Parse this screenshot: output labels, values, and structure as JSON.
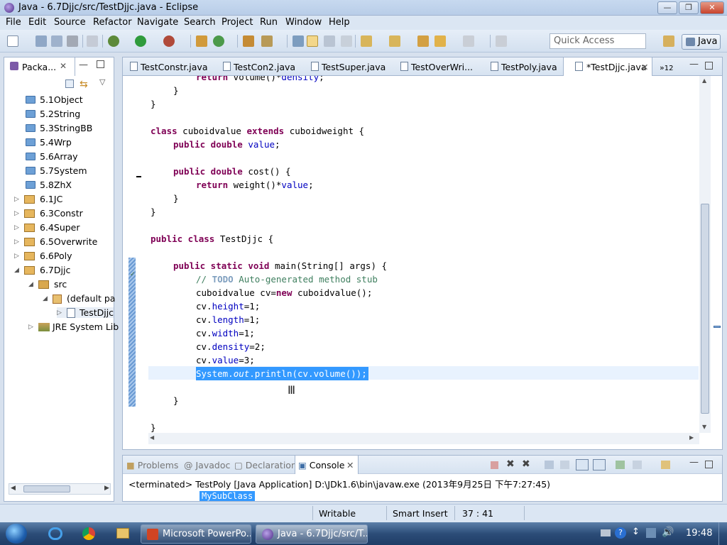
{
  "window": {
    "title": "Java - 6.7Djjc/src/TestDjjc.java - Eclipse"
  },
  "menu": [
    "File",
    "Edit",
    "Source",
    "Refactor",
    "Navigate",
    "Search",
    "Project",
    "Run",
    "Window",
    "Help"
  ],
  "toolbar": {
    "quick_access_placeholder": "Quick Access",
    "perspective": "Java"
  },
  "package_explorer": {
    "tab": "Packa...",
    "items": [
      "5.1Object",
      "5.2String",
      "5.3StringBB",
      "5.4Wrp",
      "5.6Array",
      "5.7System",
      "5.8ZhX",
      "6.1JC",
      "6.3Constr",
      "6.4Super",
      "6.5Overwrite",
      "6.6Poly",
      "6.7Djjc",
      "src",
      "(default pa",
      "TestDjjc",
      "JRE System Lib"
    ]
  },
  "editor": {
    "tabs": [
      "TestConstr.java",
      "TestCon2.java",
      "TestSuper.java",
      "TestOverWri...",
      "TestPoly.java",
      "*TestDjjc.java"
    ],
    "overflow_count": "12",
    "code": {
      "l0": "return volume()*density;",
      "l1": "}",
      "l2": "}",
      "l3_kw1": "class",
      "l3_name": " cuboidvalue ",
      "l3_kw2": "extends",
      "l3_rest": " cuboidweight {",
      "l4_kw": "public double",
      "l4_field": "value",
      "l4_end": ";",
      "l5_kw": "public double",
      "l5_rest": " cost() {",
      "l6_kw": "return",
      "l6_rest": " weight()*",
      "l6_field": "value",
      "l6_end": ";",
      "l7": "}",
      "l8": "}",
      "l9_kw": "public class",
      "l9_rest": " TestDjjc {",
      "l10_kw": "public static void",
      "l10_rest": " main(String[] args) {",
      "l11_c1": "// ",
      "l11_todo": "TODO",
      "l11_c2": " Auto-generated method stub",
      "l12_a": "cuboidvalue cv=",
      "l12_kw": "new",
      "l12_b": " cuboidvalue();",
      "l13_a": "cv.",
      "l13_f": "height",
      "l13_b": "=1;",
      "l14_a": "cv.",
      "l14_f": "length",
      "l14_b": "=1;",
      "l15_a": "cv.",
      "l15_f": "width",
      "l15_b": "=1;",
      "l16_a": "cv.",
      "l16_f": "density",
      "l16_b": "=2;",
      "l17_a": "cv.",
      "l17_f": "value",
      "l17_b": "=3;",
      "l18_a": "System.",
      "l18_out": "out",
      "l18_b": ".println(cv.volume());",
      "l19": "}",
      "l20": "}"
    }
  },
  "console": {
    "tabs": [
      "Problems",
      "Javadoc",
      "Declaration",
      "Console"
    ],
    "terminated": "<terminated> TestPoly [Java Application] D:\\JDk1.6\\bin\\javaw.exe (2013年9月25日 下午7:27:45)",
    "partial_output": "MySubClass"
  },
  "status": {
    "writable": "Writable",
    "insert_mode": "Smart Insert",
    "position": "37 : 41"
  },
  "taskbar": {
    "items": [
      "Microsoft PowerPo...",
      "Java - 6.7Djjc/src/T..."
    ],
    "clock": "19:48"
  },
  "colors": {
    "accent": "#3f6fa7",
    "selection": "#3399ff",
    "current_line": "#e8f2fe",
    "keyword": "#7f0055",
    "field": "#0000c0",
    "comment": "#3f7f5f"
  }
}
